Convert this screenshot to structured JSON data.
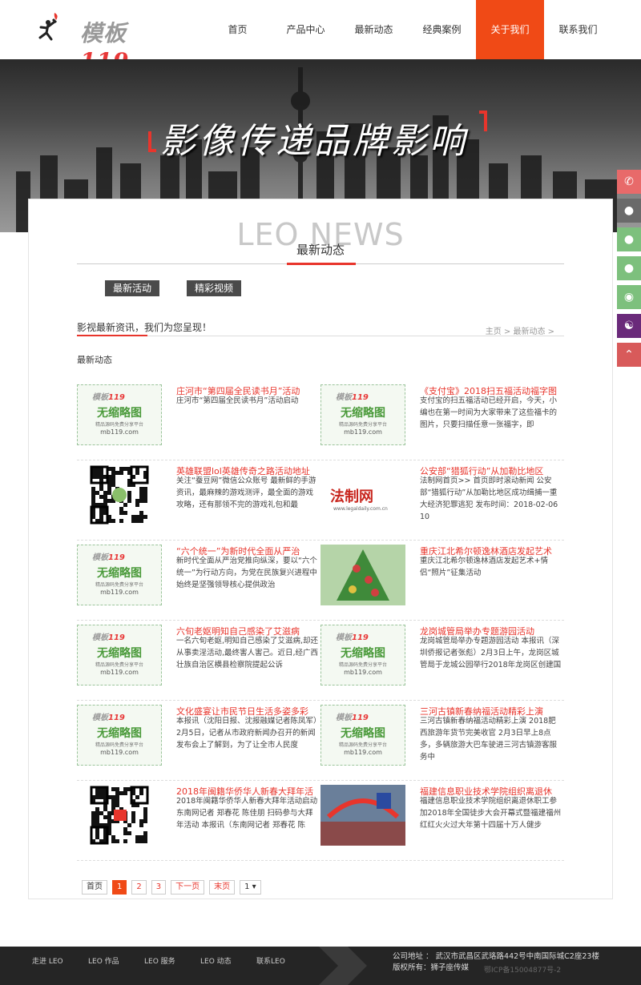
{
  "header": {
    "logo_text": "模板",
    "logo_num": "119",
    "nav": [
      "首页",
      "产品中心",
      "最新动态",
      "经典案例",
      "关于我们",
      "联系我们"
    ]
  },
  "banner": {
    "title": "影像传递品牌影响"
  },
  "sidetools": [
    "phone-icon",
    "qq-icon",
    "qq-icon",
    "qq-icon",
    "weibo-icon",
    "wechat-icon",
    "back-to-top-icon"
  ],
  "section": {
    "title_en": "LEO NEWS",
    "title_cn": "最新动态",
    "tabs": [
      "最新活动",
      "精彩视频"
    ],
    "tagline": "影视最新资讯，我们为您呈现！",
    "breadcrumb": "主页 > 最新动态 >",
    "list_title": "最新动态"
  },
  "nothumb": {
    "top": "模板",
    "top_num": "119",
    "main": "无缩略图",
    "sub": "精品源码免费分享平台",
    "url": "mb119.com"
  },
  "fazhi": {
    "name": "法制网",
    "url": "www.legaldaily.com.cn"
  },
  "news": [
    [
      {
        "thumb": "nothumb",
        "title": "庄河市“第四届全民读书月”活动",
        "desc": "庄河市“第四届全民读书月”活动启动"
      },
      {
        "thumb": "nothumb",
        "title": "《支付宝》2018扫五福活动福字图",
        "desc": "支付宝的扫五福活动已经开启，今天，小编也在第一时间为大家带来了这些福卡的图片，只要扫描任意一张福字，即"
      }
    ],
    [
      {
        "thumb": "qr",
        "title": "英雄联盟lol英雄传奇之路活动地址",
        "desc": "关注“蚕豆网”微信公众账号 最新鲜的手游资讯，最麻辣的游戏测评，最全面的游戏攻略，还有那领不完的游戏礼包和最"
      },
      {
        "thumb": "fz",
        "title": "公安部“猎狐行动”从加勒比地区",
        "desc": "法制网首页>> 首页即时滚动新闻 公安部“猎狐行动”从加勒比地区成功缉捕一重大经济犯罪逃犯 发布时间：2018-02-06 10"
      }
    ],
    [
      {
        "thumb": "nothumb",
        "title": "“六个统一”为新时代全面从严治",
        "desc": "新时代全面从严治党推向纵深，要以“六个统一”为行动方向，为党在民族复兴进程中始终是坚强领导核心提供政治"
      },
      {
        "thumb": "tree",
        "title": "重庆江北希尔顿逸林酒店发起艺术",
        "desc": "重庆江北希尔顿逸林酒店发起艺术+情侣“照片”征集活动"
      }
    ],
    [
      {
        "thumb": "nothumb",
        "title": "六旬老妪明知自己感染了艾滋病",
        "desc": "一名六旬老妪,明知自己感染了艾滋病,却还从事卖淫活动,最终害人害己。近日,经广西壮族自治区横县检察院提起公诉"
      },
      {
        "thumb": "nothumb",
        "title": "龙岗城管局举办专题游园活动",
        "desc": "龙岗城管局举办专题游园活动 本报讯（深圳侨报记者张彪）2月3日上午，龙岗区城管局于龙城公园举行2018年龙岗区创建国"
      }
    ],
    [
      {
        "thumb": "nothumb",
        "title": "文化盛宴让市民节日生活多姿多彩",
        "desc": "本报讯（沈阳日报、沈报融媒记者陈凤军）2月5日，记者从市政府新闻办召开的新闻发布会上了解到，为了让全市人民度"
      },
      {
        "thumb": "nothumb",
        "title": "三河古镇新春纳福活动精彩上演",
        "desc": "三河古镇新春纳福活动精彩上演 2018肥西旅游年货节完美收官 2月3日早上8点多，多辆旅游大巴车驶进三河古镇游客服务中"
      }
    ],
    [
      {
        "thumb": "qr2",
        "title": "2018年闽籍华侨华人新春大拜年活",
        "desc": "2018年闽籍华侨华人新春大拜年活动启动 东南网记者 郑春花 陈佳朋 扫码参与大拜年活动 本报讯（东南网记者 郑春花 陈"
      },
      {
        "thumb": "photo",
        "title": "福建信息职业技术学院组织离退休",
        "desc": "福建信息职业技术学院组织离退休职工参加2018年全国徒步大会开幕式暨福建福州红红火火过大年第十四届十万人健步"
      }
    ]
  ],
  "pager": [
    "首页",
    "1",
    "2",
    "3",
    "下一页",
    "末页",
    "1"
  ],
  "footer": {
    "nav": [
      "走进 LEO",
      "LEO 作品",
      "LEO 服务",
      "LEO 动态",
      "联系LEO"
    ],
    "address": "公司地址 ： 武汉市武昌区武珞路442号中南国际城C2座23楼",
    "copyright": "版权所有：狮子座传媒",
    "icp": "鄂ICP备15004877号-2"
  }
}
